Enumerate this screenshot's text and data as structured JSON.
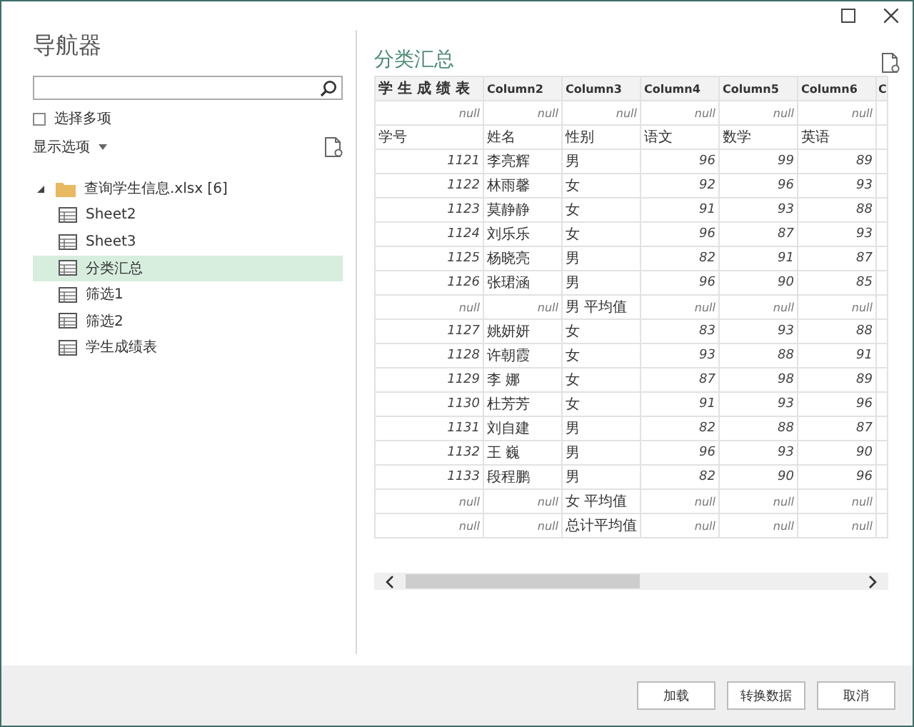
{
  "window": {
    "title": "导航器"
  },
  "multi_select": {
    "label": "选择多项",
    "checked": false
  },
  "display_options": {
    "label": "显示选项"
  },
  "tree": [
    {
      "label": "查询学生信息.xlsx [6]",
      "expanded": true,
      "selected": false,
      "children": [
        {
          "label": "Sheet2",
          "selected": false
        },
        {
          "label": "Sheet3",
          "selected": false
        },
        {
          "label": "分类汇总",
          "selected": true
        },
        {
          "label": "筛选1",
          "selected": false
        },
        {
          "label": "筛选2",
          "selected": false
        },
        {
          "label": "学生成绩表",
          "selected": false
        }
      ]
    }
  ],
  "preview": {
    "title": "分类汇总",
    "columns": [
      "学 生 成 绩 表",
      "Column2",
      "Column3",
      "Column4",
      "Column5",
      "Column6",
      "C"
    ],
    "rows": [
      [
        {
          "v": "null",
          "kind": "null"
        },
        {
          "v": "null",
          "kind": "null"
        },
        {
          "v": "null",
          "kind": "null"
        },
        {
          "v": "null",
          "kind": "null"
        },
        {
          "v": "null",
          "kind": "null"
        },
        {
          "v": "null",
          "kind": "null"
        }
      ],
      [
        {
          "v": "学号",
          "kind": "text"
        },
        {
          "v": "姓名",
          "kind": "text"
        },
        {
          "v": "性别",
          "kind": "text"
        },
        {
          "v": "语文",
          "kind": "text"
        },
        {
          "v": "数学",
          "kind": "text"
        },
        {
          "v": "英语",
          "kind": "text"
        }
      ],
      [
        {
          "v": "1121",
          "kind": "number"
        },
        {
          "v": "李亮辉",
          "kind": "text"
        },
        {
          "v": "男",
          "kind": "text"
        },
        {
          "v": "96",
          "kind": "number"
        },
        {
          "v": "99",
          "kind": "number"
        },
        {
          "v": "89",
          "kind": "number"
        }
      ],
      [
        {
          "v": "1122",
          "kind": "number"
        },
        {
          "v": "林雨馨",
          "kind": "text"
        },
        {
          "v": "女",
          "kind": "text"
        },
        {
          "v": "92",
          "kind": "number"
        },
        {
          "v": "96",
          "kind": "number"
        },
        {
          "v": "93",
          "kind": "number"
        }
      ],
      [
        {
          "v": "1123",
          "kind": "number"
        },
        {
          "v": "莫静静",
          "kind": "text"
        },
        {
          "v": "女",
          "kind": "text"
        },
        {
          "v": "91",
          "kind": "number"
        },
        {
          "v": "93",
          "kind": "number"
        },
        {
          "v": "88",
          "kind": "number"
        }
      ],
      [
        {
          "v": "1124",
          "kind": "number"
        },
        {
          "v": "刘乐乐",
          "kind": "text"
        },
        {
          "v": "女",
          "kind": "text"
        },
        {
          "v": "96",
          "kind": "number"
        },
        {
          "v": "87",
          "kind": "number"
        },
        {
          "v": "93",
          "kind": "number"
        }
      ],
      [
        {
          "v": "1125",
          "kind": "number"
        },
        {
          "v": "杨晓亮",
          "kind": "text"
        },
        {
          "v": "男",
          "kind": "text"
        },
        {
          "v": "82",
          "kind": "number"
        },
        {
          "v": "91",
          "kind": "number"
        },
        {
          "v": "87",
          "kind": "number"
        }
      ],
      [
        {
          "v": "1126",
          "kind": "number"
        },
        {
          "v": "张珺涵",
          "kind": "text"
        },
        {
          "v": "男",
          "kind": "text"
        },
        {
          "v": "96",
          "kind": "number"
        },
        {
          "v": "90",
          "kind": "number"
        },
        {
          "v": "85",
          "kind": "number"
        }
      ],
      [
        {
          "v": "null",
          "kind": "null"
        },
        {
          "v": "null",
          "kind": "null"
        },
        {
          "v": "男 平均值",
          "kind": "text"
        },
        {
          "v": "null",
          "kind": "null"
        },
        {
          "v": "null",
          "kind": "null"
        },
        {
          "v": "null",
          "kind": "null"
        }
      ],
      [
        {
          "v": "1127",
          "kind": "number"
        },
        {
          "v": "姚妍妍",
          "kind": "text"
        },
        {
          "v": "女",
          "kind": "text"
        },
        {
          "v": "83",
          "kind": "number"
        },
        {
          "v": "93",
          "kind": "number"
        },
        {
          "v": "88",
          "kind": "number"
        }
      ],
      [
        {
          "v": "1128",
          "kind": "number"
        },
        {
          "v": "许朝霞",
          "kind": "text"
        },
        {
          "v": "女",
          "kind": "text"
        },
        {
          "v": "93",
          "kind": "number"
        },
        {
          "v": "88",
          "kind": "number"
        },
        {
          "v": "91",
          "kind": "number"
        }
      ],
      [
        {
          "v": "1129",
          "kind": "number"
        },
        {
          "v": "李 娜",
          "kind": "text"
        },
        {
          "v": "女",
          "kind": "text"
        },
        {
          "v": "87",
          "kind": "number"
        },
        {
          "v": "98",
          "kind": "number"
        },
        {
          "v": "89",
          "kind": "number"
        }
      ],
      [
        {
          "v": "1130",
          "kind": "number"
        },
        {
          "v": "杜芳芳",
          "kind": "text"
        },
        {
          "v": "女",
          "kind": "text"
        },
        {
          "v": "91",
          "kind": "number"
        },
        {
          "v": "93",
          "kind": "number"
        },
        {
          "v": "96",
          "kind": "number"
        }
      ],
      [
        {
          "v": "1131",
          "kind": "number"
        },
        {
          "v": "刘自建",
          "kind": "text"
        },
        {
          "v": "男",
          "kind": "text"
        },
        {
          "v": "82",
          "kind": "number"
        },
        {
          "v": "88",
          "kind": "number"
        },
        {
          "v": "87",
          "kind": "number"
        }
      ],
      [
        {
          "v": "1132",
          "kind": "number"
        },
        {
          "v": "王 巍",
          "kind": "text"
        },
        {
          "v": "男",
          "kind": "text"
        },
        {
          "v": "96",
          "kind": "number"
        },
        {
          "v": "93",
          "kind": "number"
        },
        {
          "v": "90",
          "kind": "number"
        }
      ],
      [
        {
          "v": "1133",
          "kind": "number"
        },
        {
          "v": "段程鹏",
          "kind": "text"
        },
        {
          "v": "男",
          "kind": "text"
        },
        {
          "v": "82",
          "kind": "number"
        },
        {
          "v": "90",
          "kind": "number"
        },
        {
          "v": "96",
          "kind": "number"
        }
      ],
      [
        {
          "v": "null",
          "kind": "null"
        },
        {
          "v": "null",
          "kind": "null"
        },
        {
          "v": "女 平均值",
          "kind": "text"
        },
        {
          "v": "null",
          "kind": "null"
        },
        {
          "v": "null",
          "kind": "null"
        },
        {
          "v": "null",
          "kind": "null"
        }
      ],
      [
        {
          "v": "null",
          "kind": "null"
        },
        {
          "v": "null",
          "kind": "null"
        },
        {
          "v": "总计平均值",
          "kind": "text"
        },
        {
          "v": "null",
          "kind": "null"
        },
        {
          "v": "null",
          "kind": "null"
        },
        {
          "v": "null",
          "kind": "null"
        }
      ]
    ]
  },
  "buttons": [
    "加载",
    "转换数据",
    "取消"
  ]
}
